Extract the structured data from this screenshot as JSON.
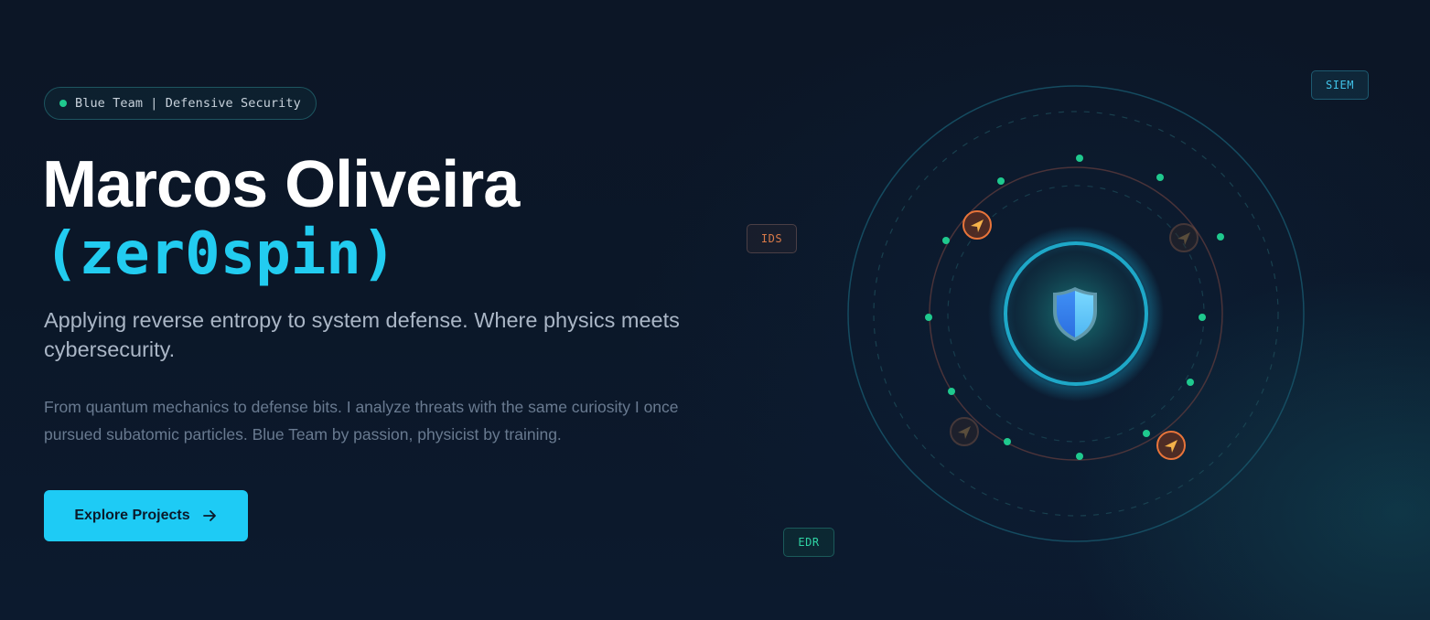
{
  "badge": {
    "text": "Blue Team | Defensive Security",
    "status_color": "#1fc98e"
  },
  "hero": {
    "name": "Marcos Oliveira",
    "handle": "(zer0spin)",
    "tagline": "Applying reverse entropy to system defense. Where physics meets cybersecurity.",
    "description": "From quantum mechanics to defense bits. I analyze threats with the same curiosity I once pursued subatomic particles. Blue Team by passion, physicist by training.",
    "cta_label": "Explore Projects",
    "cta_icon": "arrow-right-icon"
  },
  "visualization": {
    "center_icon": "shield-icon",
    "threat_icon": "arrow-threat-icon",
    "tags": {
      "siem": "SIEM",
      "ids": "IDS",
      "edr": "EDR"
    }
  },
  "colors": {
    "accent": "#1ecbf5",
    "handle": "#22ccf0",
    "node_green": "#1fc98e",
    "threat_orange": "#e8743a",
    "background": "#0c1626"
  }
}
